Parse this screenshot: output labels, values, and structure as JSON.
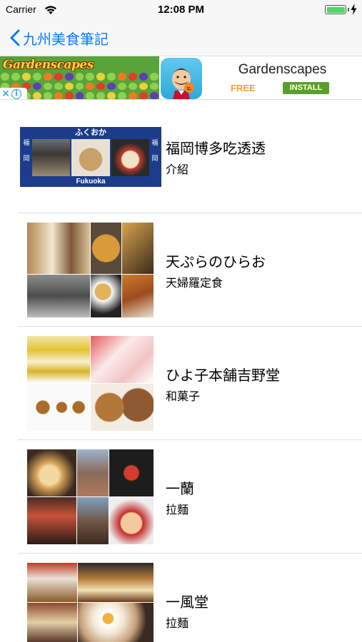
{
  "status_bar": {
    "carrier": "Carrier",
    "time": "12:08 PM",
    "battery_level": 1.0
  },
  "nav": {
    "back_label": "九州美食筆記"
  },
  "ad": {
    "game_title": "Gardenscapes",
    "app_name": "Gardenscapes",
    "free_label": "FREE",
    "install_label": "INSTALL"
  },
  "items": [
    {
      "title": "福岡博多吃透透",
      "subtitle": "介紹",
      "thumb": {
        "top_text": "ふくおか",
        "bottom_text": "Fukuoka",
        "side_left": "福\n\n岡",
        "side_right": "福\n\n岡"
      }
    },
    {
      "title": "天ぷらのひらお",
      "subtitle": "天婦羅定食"
    },
    {
      "title": "ひよ子本舗吉野堂",
      "subtitle": "和菓子"
    },
    {
      "title": "一蘭",
      "subtitle": "拉麵"
    },
    {
      "title": "一風堂",
      "subtitle": "拉麵"
    }
  ],
  "colors": {
    "tint": "#0a7aff",
    "battery": "#4cd964",
    "install": "#5a9f2a",
    "free": "#f3a02d",
    "fukuoka_bg": "#1d3c8c"
  }
}
